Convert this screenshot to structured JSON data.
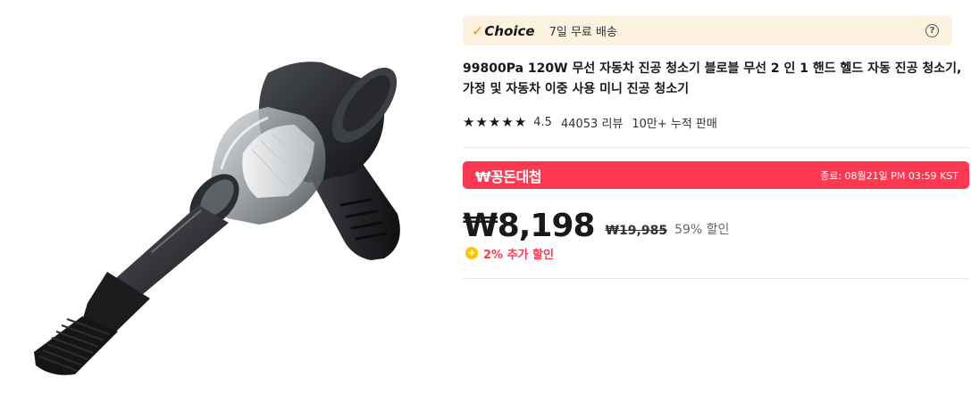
{
  "product": {
    "image_alt": "handheld vacuum cleaner"
  },
  "choice": {
    "check": "✓",
    "label": "Choice",
    "shipping": "7일 무료 배송",
    "help": "?"
  },
  "title": "99800Pa 120W 무선 자동차 진공 청소기 블로블 무선 2 인 1 핸드 헬드 자동 진공 청소기, 가정 및 자동차 이중 사용 미니 진공 청소기",
  "rating": {
    "stars": [
      "★",
      "★",
      "★",
      "★",
      "★"
    ],
    "value": "4.5",
    "reviews": "44053 리뷰",
    "sold": "10만+ 누적 판매"
  },
  "deal": {
    "title": "₩꽁돈대첩",
    "ends": "종료: 08월21일 PM 03:59 KST"
  },
  "price": {
    "current": "₩8,198",
    "original": "₩19,985",
    "discount": "59% 할인"
  },
  "extra": {
    "icon": "+",
    "text": "2% 추가 할인"
  },
  "colors": {
    "choice_bg": "#fdf2df",
    "choice_check": "#f29b00",
    "deal_red": "#fd384f",
    "coin": "#ffc400"
  }
}
